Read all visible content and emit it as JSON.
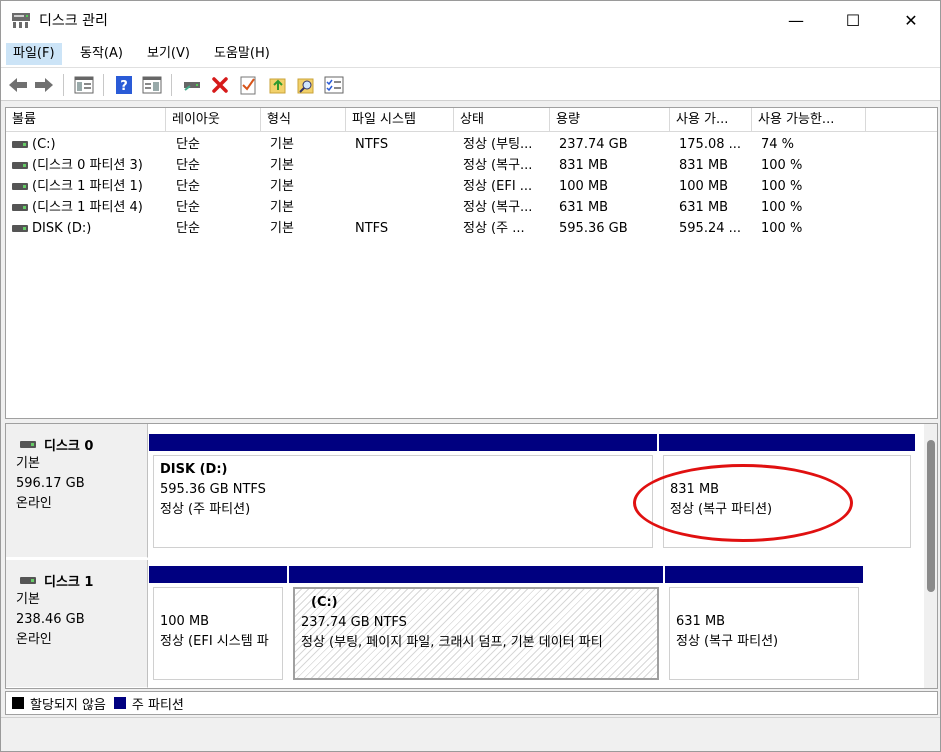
{
  "window": {
    "title": "디스크 관리",
    "minimize": "—",
    "maximize": "☐",
    "close": "✕"
  },
  "menu": [
    {
      "label": "파일(F)"
    },
    {
      "label": "동작(A)"
    },
    {
      "label": "보기(V)"
    },
    {
      "label": "도움말(H)"
    }
  ],
  "toolbar": {
    "icons": [
      "back-arrow-icon",
      "forward-arrow-icon",
      "console-icon",
      "help-icon",
      "properties-icon",
      "connect-icon",
      "delete-icon",
      "checklist-icon",
      "up-folder-icon",
      "search-folder-icon",
      "list-icon"
    ]
  },
  "volume_table": {
    "headers": [
      "볼륨",
      "레이아웃",
      "형식",
      "파일 시스템",
      "상태",
      "용량",
      "사용 가...",
      "사용 가능한..."
    ],
    "rows": [
      [
        "(C:)",
        "단순",
        "기본",
        "NTFS",
        "정상 (부팅...",
        "237.74 GB",
        "175.08 ...",
        "74 %"
      ],
      [
        "(디스크 0 파티션 3)",
        "단순",
        "기본",
        "",
        "정상 (복구...",
        "831 MB",
        "831 MB",
        "100 %"
      ],
      [
        "(디스크 1 파티션 1)",
        "단순",
        "기본",
        "",
        "정상 (EFI ...",
        "100 MB",
        "100 MB",
        "100 %"
      ],
      [
        "(디스크 1 파티션 4)",
        "단순",
        "기본",
        "",
        "정상 (복구...",
        "631 MB",
        "631 MB",
        "100 %"
      ],
      [
        "DISK (D:)",
        "단순",
        "기본",
        "NTFS",
        "정상 (주 ...",
        "595.36 GB",
        "595.24 ...",
        "100 %"
      ]
    ]
  },
  "disks": [
    {
      "name": "디스크 0",
      "type": "기본",
      "size": "596.17 GB",
      "status": "온라인",
      "partitions": [
        {
          "title": "DISK  (D:)",
          "line1": "595.36 GB NTFS",
          "line2": "정상 (주 파티션)"
        },
        {
          "title": "",
          "line1": "831 MB",
          "line2": "정상 (복구 파티션)"
        }
      ]
    },
    {
      "name": "디스크 1",
      "type": "기본",
      "size": "238.46 GB",
      "status": "온라인",
      "partitions": [
        {
          "title": "",
          "line1": "100 MB",
          "line2": "정상 (EFI 시스템 파"
        },
        {
          "title": "(C:)",
          "line1": "237.74 GB NTFS",
          "line2": "정상 (부팅, 페이지 파일, 크래시 덤프, 기본 데이터 파티"
        },
        {
          "title": "",
          "line1": "631 MB",
          "line2": "정상 (복구 파티션)"
        }
      ]
    }
  ],
  "legend": [
    {
      "label": "할당되지 않음",
      "color": "#000000"
    },
    {
      "label": "주 파티션",
      "color": "#000080"
    }
  ]
}
